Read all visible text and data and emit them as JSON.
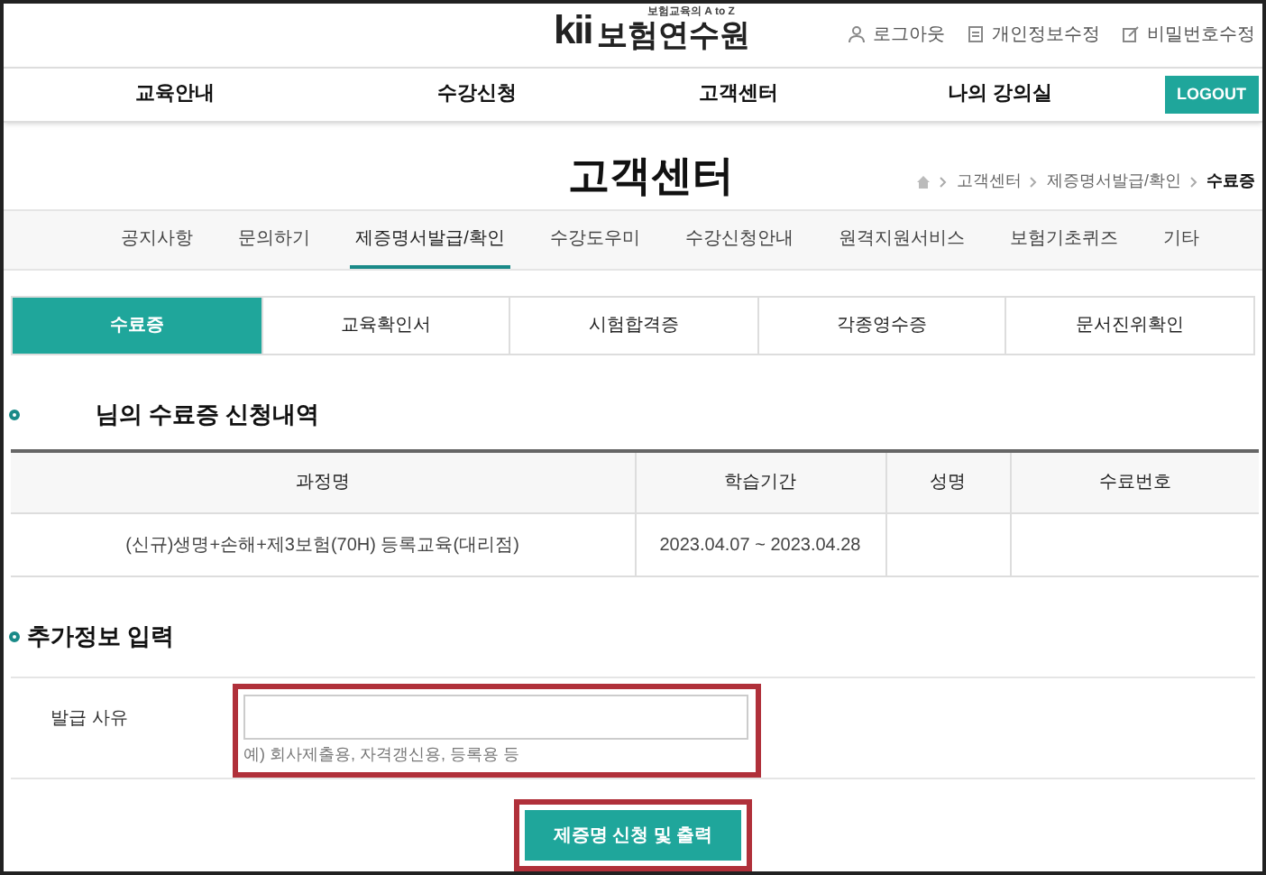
{
  "header": {
    "logo_mark": "kii",
    "logo_name": "보험연수원",
    "logo_tagline": "보험교육의 A to Z",
    "utility_links": [
      {
        "kind": "person",
        "label": "로그아웃"
      },
      {
        "kind": "doc",
        "label": "개인정보수정"
      },
      {
        "kind": "edit",
        "label": "비밀번호수정"
      }
    ]
  },
  "main_nav": {
    "items": [
      "교육안내",
      "수강신청",
      "고객센터",
      "나의 강의실"
    ],
    "logout": "LOGOUT"
  },
  "page_title": "고객센터",
  "breadcrumb": [
    "고객센터",
    "제증명서발급/확인",
    "수료증"
  ],
  "sub_nav": [
    {
      "label": "공지사항",
      "selected": false
    },
    {
      "label": "문의하기",
      "selected": false
    },
    {
      "label": "제증명서발급/확인",
      "selected": true
    },
    {
      "label": "수강도우미",
      "selected": false
    },
    {
      "label": "수강신청안내",
      "selected": false
    },
    {
      "label": "원격지원서비스",
      "selected": false
    },
    {
      "label": "보험기초퀴즈",
      "selected": false
    },
    {
      "label": "기타",
      "selected": false
    }
  ],
  "tabs": [
    {
      "label": "수료증",
      "selected": true
    },
    {
      "label": "교육확인서",
      "selected": false
    },
    {
      "label": "시험합격증",
      "selected": false
    },
    {
      "label": "각종영수증",
      "selected": false
    },
    {
      "label": "문서진위확인",
      "selected": false
    }
  ],
  "history_section": {
    "title": "님의 수료증 신청내역",
    "table": {
      "columns": [
        "과정명",
        "학습기간",
        "성명",
        "수료번호"
      ],
      "rows": [
        [
          "(신규)생명+손해+제3보험(70H) 등록교육(대리점)",
          "2023.04.07 ~ 2023.04.28"
        ]
      ]
    }
  },
  "extra_section": {
    "title": "추가정보 입력",
    "field_label": "발급 사유",
    "hint": "예) 회사제출용, 자격갱신용, 등록용 등"
  },
  "submit_button": "제증명 신청 및 출력"
}
